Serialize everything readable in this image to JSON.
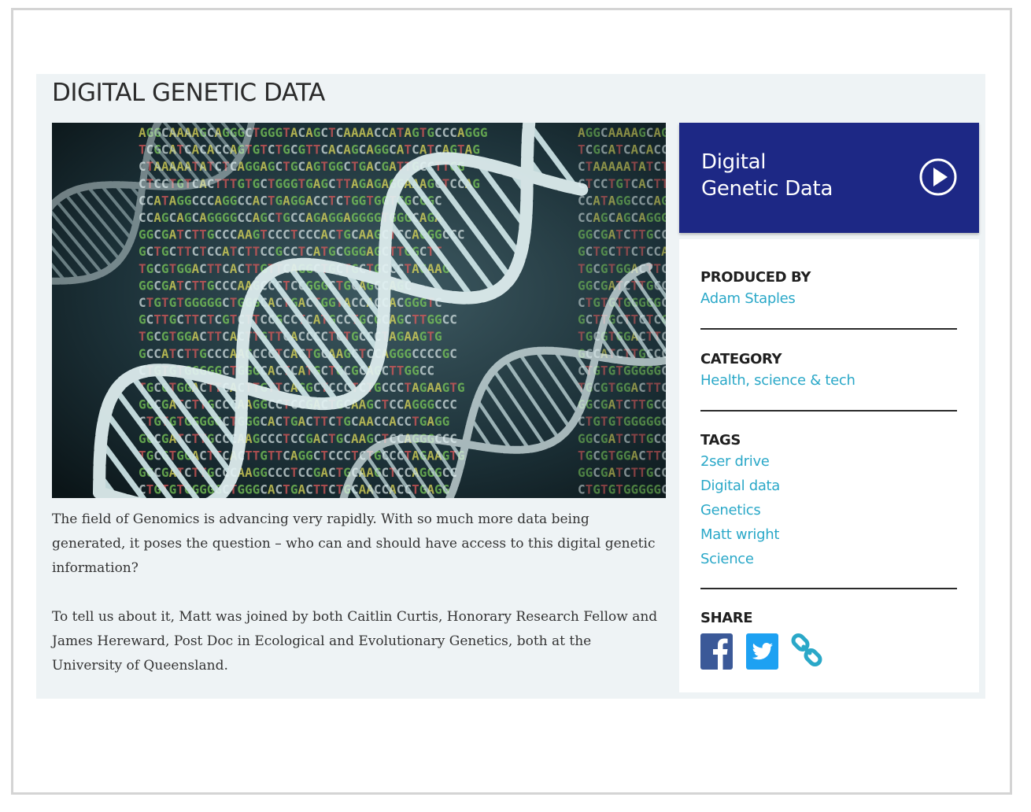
{
  "page": {
    "title": "DIGITAL GENETIC DATA"
  },
  "article": {
    "paragraphs": [
      "The field of Genomics is advancing very rapidly. With so much more data being generated, it poses the question – who can and should have access to this digital genetic information?",
      "To tell us about it, Matt was joined by both Caitlin Curtis, Honorary Research Fellow and James Hereward, Post Doc in Ecological and Evolutionary Genetics, both at the University of Queensland."
    ]
  },
  "hero_image": {
    "sequences": [
      "AGGCAAAAGCAGGGCTGGGTACAGCTCAAAACCATAGTGCCCAGGG",
      "TCGCATCACACCAGTGTCTGCGTTCACAGCAGGCATCATCAGTAG",
      "CTAAAAATATCTCAGGAGCTGCAGTGGCTGACGATTGCCTTGG",
      "CTCCTGTCACTTTGTGCTGGGTGAGCTTAGAGAGGAAAGCTCCAG",
      "CCATAGGCCCAGGCCACTGAGGACCTCTGGTGGTGGCGGC",
      "CCAGCAGCAGGGGCCAGCTGCCAGAGGAGGGGTGGGCAGA",
      "GGCGATCTTGCCCAAGTCCCTCCCACTGCAAGCTCCAGGGCCC",
      "GCTGCTTCTCCATCTTCCGCCTCATGCGGGAGCTTGGCTT",
      "TGCGTGGACTTCACTTGTTCAGGCTGCTGCTGCCCTAGAAG",
      "GGCGATCTTGCCCAAGCCCTCCGGGCTGCAGCCAGC",
      "CTGTGTGGGGGCTGGGCACTGACTGGTACCACCACGGGTC",
      "GCTTGCTTCTCGTCTTCCGCCTCATGCCTGCGCAGCTTGGCC",
      "TGCGTGGACTTCACTTGTTCACCCCTCTGCCCTAGAAGTG",
      "GCCATCTTGCCCAAGCCCTCACTGCAAGCTCCAGGGCCCCGC",
      "CTGTGTGGGGGCTGGGCACTCATGCTGCGCAGCTTGGCC",
      "TGCGTGGACTTCACTTGTTCAGGCTCCCTCTGCCCTAGAAGTG",
      "GGCGATCTTGCCCAAGGCCTCCGACTGCAAGCTCCAGGGCCC",
      "CTGTGTGGGGGCTGGGCACTGACTTCTGCAACCACCTGAGG",
      "GGCGATCTTGCCCAAGCCCTCCGACTGCAAGCTCCAGGGCCC",
      "TGCGTGGACTTCACTTGTTCAGGCTCCCTCTGCCCTAGAAGTG",
      "GGCGATCTTGCCCAAGGCCCTCCGACTGCAAGCTCCAGGGCC",
      "CTGTGTGGGGGCTGGGCACTGACTTCTGCAACCACCTGAGG"
    ]
  },
  "player": {
    "title_line1": "Digital",
    "title_line2": "Genetic Data"
  },
  "sidebar": {
    "produced_by": {
      "label": "PRODUCED BY",
      "value": "Adam Staples"
    },
    "category": {
      "label": "CATEGORY",
      "value": "Health, science & tech"
    },
    "tags": {
      "label": "TAGS",
      "items": [
        "2ser drive",
        "Digital data",
        "Genetics",
        "Matt wright",
        "Science"
      ]
    },
    "share": {
      "label": "SHARE",
      "icons": [
        "facebook-icon",
        "twitter-icon",
        "link-icon"
      ]
    }
  },
  "colors": {
    "player_bg": "#1d2885",
    "link": "#2aa8c8",
    "panel_bg": "#eef3f5",
    "facebook": "#3b5998",
    "twitter": "#1da1f2"
  }
}
